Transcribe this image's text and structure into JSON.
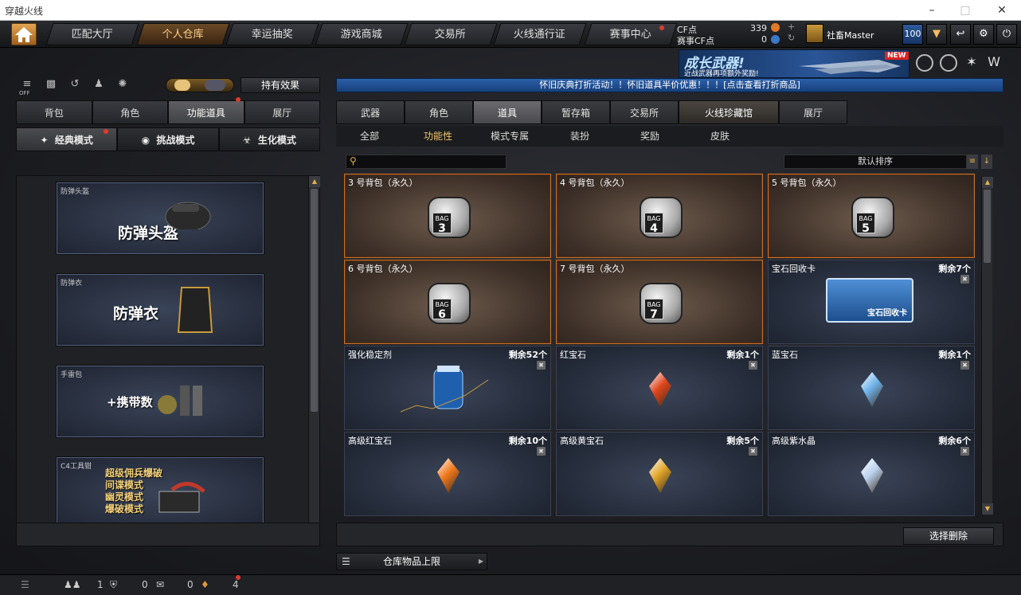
{
  "window": {
    "title": "穿越火线"
  },
  "nav": {
    "tabs": [
      "匹配大厅",
      "个人仓库",
      "幸运抽奖",
      "游戏商城",
      "交易所",
      "火线通行证",
      "赛事中心"
    ],
    "active_index": 1
  },
  "account": {
    "cf_label": "CF点",
    "cf_value": "339",
    "event_cf_label": "赛事CF点",
    "event_cf_value": "0",
    "username": "社畜Master",
    "level_badge": "100"
  },
  "banner": {
    "headline": "成长武器!",
    "sub": "近战武器再项额外奖励!",
    "tag": "NEW"
  },
  "notice": "怀旧庆典打折活动！！怀旧道具半价优惠！！！[点击查看打折商品]",
  "left": {
    "toolbar_off": "OFF",
    "effects_button": "持有效果",
    "tabs": [
      "背包",
      "角色",
      "功能道具",
      "展厅"
    ],
    "active_tab": 2,
    "modes": [
      "经典模式",
      "挑战模式",
      "生化模式"
    ],
    "active_mode": 0,
    "equipment": [
      {
        "label": "防弹头盔",
        "title": "防弹头盔"
      },
      {
        "label": "防弹衣",
        "title": "防弹衣"
      },
      {
        "label": "手雷包",
        "title": "+携带数"
      },
      {
        "label": "C4工具钳",
        "lines": [
          "超级佣兵爆破",
          "间谍模式",
          "幽灵模式",
          "爆破模式"
        ]
      }
    ]
  },
  "right": {
    "tabs": [
      "武器",
      "角色",
      "道具",
      "暂存箱",
      "交易所",
      "火线珍藏馆",
      "展厅"
    ],
    "active_tab": 2,
    "subtabs": [
      "全部",
      "功能性",
      "模式专属",
      "装扮",
      "奖励",
      "皮肤"
    ],
    "active_subtab": 1,
    "sort_label": "默认排序",
    "items": [
      {
        "name": "3 号背包（永久）",
        "kind": "bag",
        "num": "3"
      },
      {
        "name": "4 号背包（永久）",
        "kind": "bag",
        "num": "4"
      },
      {
        "name": "5 号背包（永久）",
        "kind": "bag",
        "num": "5"
      },
      {
        "name": "6 号背包（永久）",
        "kind": "bag",
        "num": "6"
      },
      {
        "name": "7 号背包（永久）",
        "kind": "bag",
        "num": "7"
      },
      {
        "name": "宝石回收卡",
        "kind": "card",
        "remain": "剩余7个",
        "card_text": "宝石回收卡"
      },
      {
        "name": "强化稳定剂",
        "kind": "stabilizer",
        "remain": "剩余52个"
      },
      {
        "name": "红宝石",
        "kind": "gem",
        "remain": "剩余1个",
        "color": "#e0461c"
      },
      {
        "name": "蓝宝石",
        "kind": "gem",
        "remain": "剩余1个",
        "color": "#6fb3ea"
      },
      {
        "name": "高级红宝石",
        "kind": "gem",
        "remain": "剩余10个",
        "color": "#f07a1e"
      },
      {
        "name": "高级黄宝石",
        "kind": "gem",
        "remain": "剩余5个",
        "color": "#e2a52a"
      },
      {
        "name": "高级紫水晶",
        "kind": "gem",
        "remain": "剩余6个",
        "color": "#bcd2ee"
      }
    ],
    "delete_button": "选择删除",
    "storage_button": "仓库物品上限"
  },
  "status": {
    "friends": "1",
    "shield": "0",
    "chat": "0",
    "gift": "4"
  },
  "colors": {
    "accent": "#f0c46a",
    "bag_border": "#c8702a",
    "notice_bg": "#2b5fa8"
  }
}
